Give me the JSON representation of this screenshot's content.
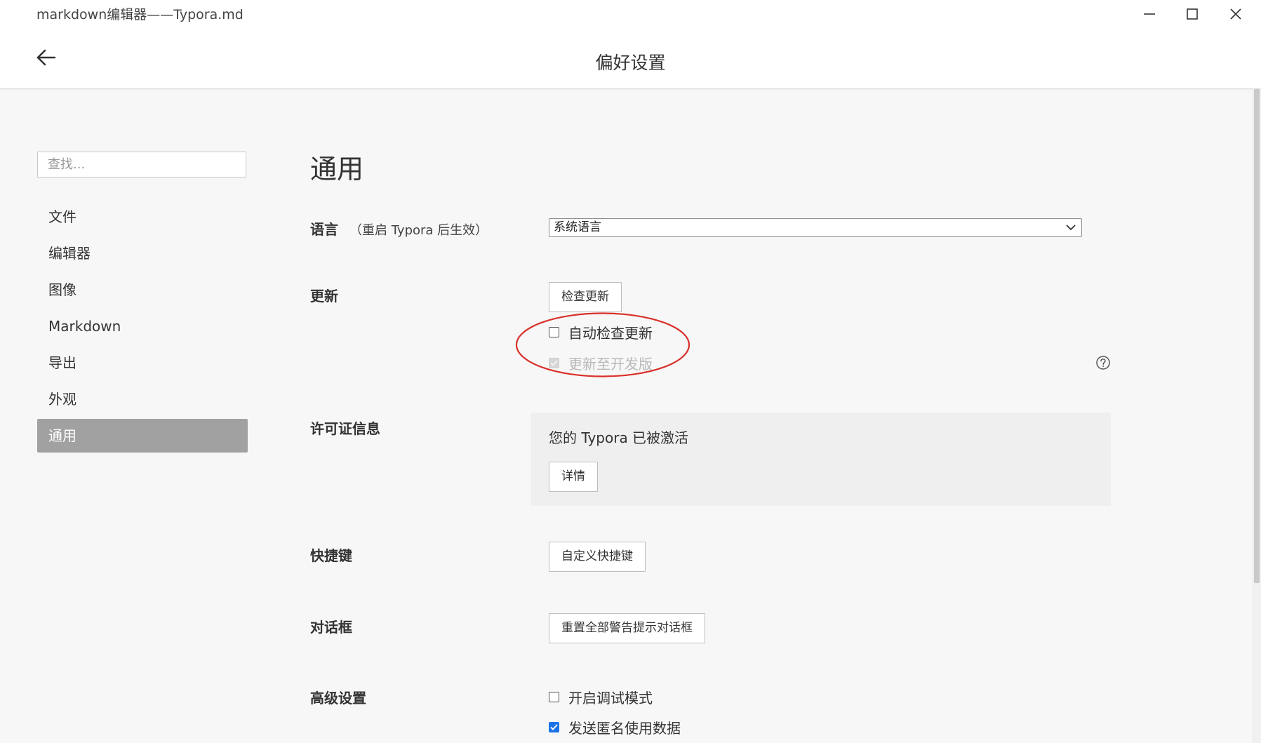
{
  "window": {
    "title": "markdown编辑器——Typora.md",
    "page_title": "偏好设置"
  },
  "sidebar": {
    "search_placeholder": "查找...",
    "items": [
      {
        "label": "文件"
      },
      {
        "label": "编辑器"
      },
      {
        "label": "图像"
      },
      {
        "label": "Markdown"
      },
      {
        "label": "导出"
      },
      {
        "label": "外观"
      },
      {
        "label": "通用",
        "active": true
      }
    ]
  },
  "main": {
    "heading": "通用",
    "language": {
      "label": "语言",
      "note": "（重启 Typora 后生效）",
      "selected": "系统语言"
    },
    "update": {
      "label": "更新",
      "check_button": "检查更新",
      "auto_check": {
        "label": "自动检查更新",
        "checked": false
      },
      "dev_channel": {
        "label": "更新至开发版",
        "checked": true,
        "disabled": true
      }
    },
    "license": {
      "label": "许可证信息",
      "status": "您的 Typora 已被激活",
      "details_button": "详情"
    },
    "shortcuts": {
      "label": "快捷键",
      "button": "自定义快捷键"
    },
    "dialogs": {
      "label": "对话框",
      "button": "重置全部警告提示对话框"
    },
    "advanced": {
      "label": "高级设置",
      "debug_mode": {
        "label": "开启调试模式",
        "checked": false
      },
      "send_usage": {
        "label": "发送匿名使用数据",
        "checked": true
      }
    }
  },
  "colors": {
    "active_nav": "#a2a1a1",
    "checkbox_checked": "#1a73e8",
    "annotation_circle": "#d9302a"
  },
  "icons": {
    "back": "arrow-left-icon",
    "minimize": "minimize-icon",
    "maximize": "maximize-icon",
    "close": "close-icon",
    "dropdown": "chevron-down-icon",
    "help": "question-circle-icon"
  }
}
